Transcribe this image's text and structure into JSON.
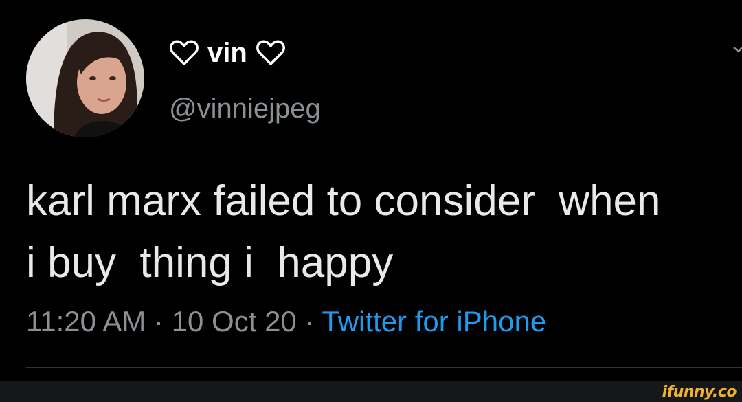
{
  "user": {
    "display_name": "vin",
    "name_decoration_icon": "heart-outline-icon",
    "handle": "@vinniejpeg",
    "avatar": "profile-photo"
  },
  "tweet": {
    "line1": "karl marx failed to consider  when",
    "line2": "i buy  thing i  happy"
  },
  "meta": {
    "time": "11:20 AM",
    "separator": " · ",
    "date": "10 Oct 20",
    "source": "Twitter for iPhone"
  },
  "watermark": "ifunny.co",
  "colors": {
    "background": "#000000",
    "text": "#e7e9ea",
    "muted": "#8b9095",
    "link": "#1d9bf0",
    "watermark": "#f2b230"
  }
}
